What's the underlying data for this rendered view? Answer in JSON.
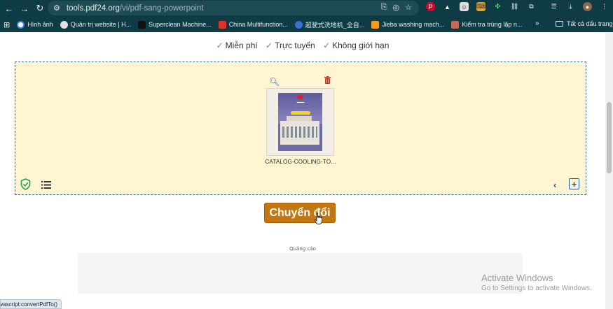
{
  "browser": {
    "url_host": "tools.pdf24.org",
    "url_path": "/vi/pdf-sang-powerpoint",
    "bookmarks": [
      {
        "label": "Hình ảnh",
        "color": "#ffffff"
      },
      {
        "label": "Quản trị website | H...",
        "color": "#e0e0e0"
      },
      {
        "label": "Superclean Machine...",
        "color": "#111111"
      },
      {
        "label": "China Multifunction...",
        "color": "#d9342b"
      },
      {
        "label": "超驶式洗地机_全自...",
        "color": "#3b6fd8"
      },
      {
        "label": "Jieba washing mach...",
        "color": "#f29b1d"
      },
      {
        "label": "Kiểm tra trùng lặp n...",
        "color": "#c46a5a"
      }
    ],
    "bookmarks_more": "»",
    "all_bookmarks": "Tất cả dấu trang"
  },
  "page": {
    "features": [
      "Miễn phí",
      "Trực tuyến",
      "Không giới hạn"
    ],
    "file_name": "CATALOG-COOLING-TO...",
    "convert_label": "Chuyển đổi",
    "ad_label": "Quảng cáo",
    "accent_color": "#c27710",
    "link_color": "#1e5a9a"
  },
  "os": {
    "watermark_line1": "Activate Windows",
    "watermark_line2": "Go to Settings to activate Windows."
  },
  "status": {
    "text": "javascript:convertPdfTo()"
  }
}
